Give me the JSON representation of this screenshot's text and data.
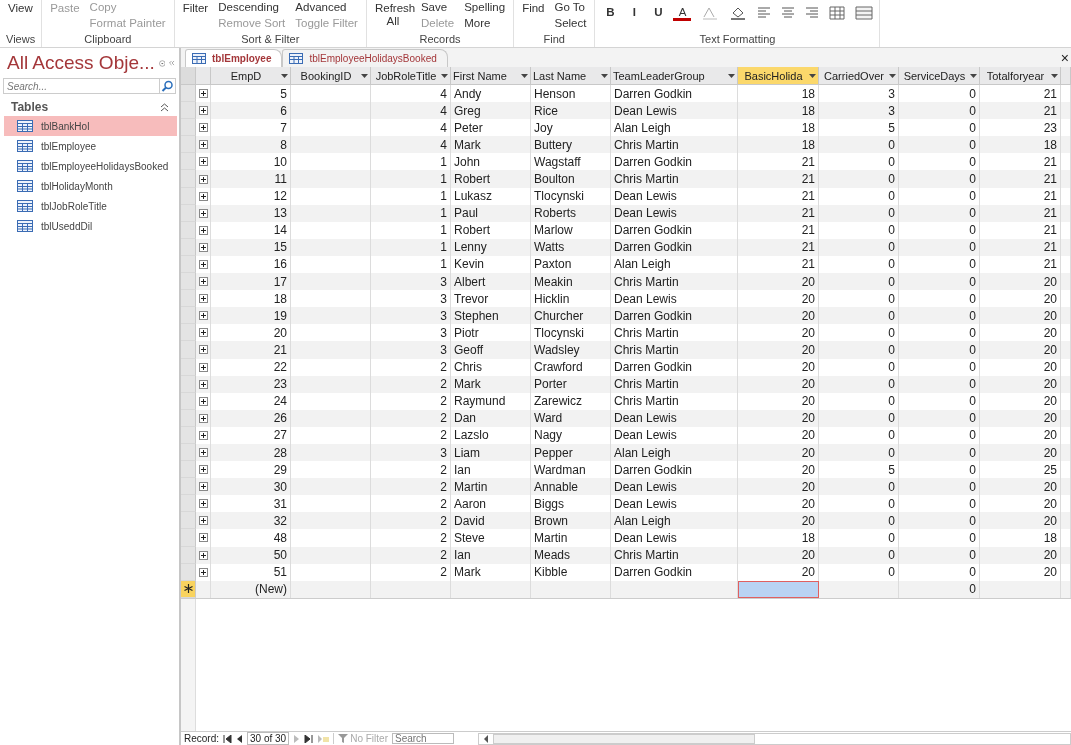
{
  "ribbon": {
    "groups": [
      {
        "label": "Views",
        "columns": [
          [
            {
              "label": "View",
              "kind": "large",
              "disabled": false
            }
          ]
        ]
      },
      {
        "label": "Clipboard",
        "columns": [
          [
            {
              "label": "Paste",
              "kind": "large",
              "disabled": true
            }
          ],
          [
            {
              "label": "Copy",
              "kind": "small",
              "disabled": true
            },
            {
              "label": "Format Painter",
              "kind": "small",
              "disabled": true
            }
          ]
        ]
      },
      {
        "label": "Sort & Filter",
        "columns": [
          [
            {
              "label": "Filter",
              "kind": "large",
              "disabled": false
            }
          ],
          [
            {
              "label": "Descending",
              "kind": "small",
              "disabled": false
            },
            {
              "label": "Remove Sort",
              "kind": "small",
              "disabled": true
            }
          ],
          [
            {
              "label": "Advanced",
              "kind": "small",
              "disabled": false
            },
            {
              "label": "Toggle Filter",
              "kind": "small",
              "disabled": true
            }
          ]
        ]
      },
      {
        "label": "Records",
        "columns": [
          [
            {
              "label": "Refresh All",
              "kind": "large",
              "disabled": false
            }
          ],
          [
            {
              "label": "Save",
              "kind": "small",
              "disabled": false
            },
            {
              "label": "Delete",
              "kind": "small",
              "disabled": true
            }
          ],
          [
            {
              "label": "Spelling",
              "kind": "small",
              "disabled": false
            },
            {
              "label": "More",
              "kind": "small",
              "disabled": false
            }
          ]
        ]
      },
      {
        "label": "Find",
        "columns": [
          [
            {
              "label": "Find",
              "kind": "large",
              "disabled": false
            }
          ],
          [
            {
              "label": "Go To",
              "kind": "small",
              "disabled": false
            },
            {
              "label": "Select",
              "kind": "small",
              "disabled": false
            }
          ]
        ]
      },
      {
        "label": "Text Formatting",
        "columns": [
          [
            {
              "label": "B",
              "kind": "format",
              "disabled": false
            }
          ],
          [
            {
              "label": "I",
              "kind": "format",
              "disabled": false
            }
          ],
          [
            {
              "label": "U",
              "kind": "format",
              "disabled": false
            }
          ],
          [
            {
              "label": "A",
              "kind": "font-color",
              "disabled": false
            }
          ]
        ]
      }
    ]
  },
  "nav_pane": {
    "title": "All Access Obje...",
    "search": {
      "placeholder": "Search..."
    },
    "section": "Tables",
    "items": [
      {
        "label": "tblBankHol",
        "selected": true
      },
      {
        "label": "tblEmployee",
        "selected": false
      },
      {
        "label": "tblEmployeeHolidaysBooked",
        "selected": false
      },
      {
        "label": "tblHolidayMonth",
        "selected": false
      },
      {
        "label": "tblJobRoleTitle",
        "selected": false
      },
      {
        "label": "tblUseddDil",
        "selected": false
      }
    ]
  },
  "tabs": [
    {
      "label": "tblEmployee",
      "selected": true
    },
    {
      "label": "tblEmployeeHolidaysBooked",
      "selected": false
    }
  ],
  "close_glyph": "×",
  "table": {
    "columns": [
      {
        "label": "EmpD",
        "kind": "number",
        "selected": false
      },
      {
        "label": "BookingID",
        "kind": "number",
        "selected": false
      },
      {
        "label": "JobRoleTitle",
        "kind": "number",
        "selected": false
      },
      {
        "label": "First Name",
        "kind": "text",
        "selected": false
      },
      {
        "label": "Last Name",
        "kind": "text",
        "selected": false
      },
      {
        "label": "TeamLeaderGroup",
        "kind": "text",
        "selected": false
      },
      {
        "label": "BasicHolida",
        "kind": "number",
        "selected": true
      },
      {
        "label": "CarriedOver",
        "kind": "number",
        "selected": false
      },
      {
        "label": "ServiceDays",
        "kind": "number",
        "selected": false
      },
      {
        "label": "Totalforyear",
        "kind": "number",
        "selected": false
      }
    ],
    "rows": [
      [
        "5",
        null,
        "4",
        "Andy",
        "Henson",
        "Darren Godkin",
        "18",
        "3",
        "0",
        "21"
      ],
      [
        "6",
        null,
        "4",
        "Greg",
        "Rice",
        "Dean Lewis",
        "18",
        "3",
        "0",
        "21"
      ],
      [
        "7",
        null,
        "4",
        "Peter",
        "Joy",
        "Alan Leigh",
        "18",
        "5",
        "0",
        "23"
      ],
      [
        "8",
        null,
        "4",
        "Mark",
        "Buttery",
        "Chris Martin",
        "18",
        "0",
        "0",
        "18"
      ],
      [
        "10",
        null,
        "1",
        "John",
        "Wagstaff",
        "Darren Godkin",
        "21",
        "0",
        "0",
        "21"
      ],
      [
        "11",
        null,
        "1",
        "Robert",
        "Boulton",
        "Chris Martin",
        "21",
        "0",
        "0",
        "21"
      ],
      [
        "12",
        null,
        "1",
        "Lukasz",
        "Tlocynski",
        "Dean Lewis",
        "21",
        "0",
        "0",
        "21"
      ],
      [
        "13",
        null,
        "1",
        "Paul",
        "Roberts",
        "Dean Lewis",
        "21",
        "0",
        "0",
        "21"
      ],
      [
        "14",
        null,
        "1",
        "Robert",
        "Marlow",
        "Darren Godkin",
        "21",
        "0",
        "0",
        "21"
      ],
      [
        "15",
        null,
        "1",
        "Lenny",
        "Watts",
        "Darren Godkin",
        "21",
        "0",
        "0",
        "21"
      ],
      [
        "16",
        null,
        "1",
        "Kevin",
        "Paxton",
        "Alan Leigh",
        "21",
        "0",
        "0",
        "21"
      ],
      [
        "17",
        null,
        "3",
        "Albert",
        "Meakin",
        "Chris Martin",
        "20",
        "0",
        "0",
        "20"
      ],
      [
        "18",
        null,
        "3",
        "Trevor",
        "Hicklin",
        "Dean Lewis",
        "20",
        "0",
        "0",
        "20"
      ],
      [
        "19",
        null,
        "3",
        "Stephen",
        "Churcher",
        "Darren Godkin",
        "20",
        "0",
        "0",
        "20"
      ],
      [
        "20",
        null,
        "3",
        "Piotr",
        "Tlocynski",
        "Chris Martin",
        "20",
        "0",
        "0",
        "20"
      ],
      [
        "21",
        null,
        "3",
        "Geoff",
        "Wadsley",
        "Chris Martin",
        "20",
        "0",
        "0",
        "20"
      ],
      [
        "22",
        null,
        "2",
        "Chris",
        "Crawford",
        "Darren Godkin",
        "20",
        "0",
        "0",
        "20"
      ],
      [
        "23",
        null,
        "2",
        "Mark",
        "Porter",
        "Chris Martin",
        "20",
        "0",
        "0",
        "20"
      ],
      [
        "24",
        null,
        "2",
        "Raymund",
        "Zarewicz",
        "Chris Martin",
        "20",
        "0",
        "0",
        "20"
      ],
      [
        "26",
        null,
        "2",
        "Dan",
        "Ward",
        "Dean Lewis",
        "20",
        "0",
        "0",
        "20"
      ],
      [
        "27",
        null,
        "2",
        "Lazslo",
        "Nagy",
        "Dean Lewis",
        "20",
        "0",
        "0",
        "20"
      ],
      [
        "28",
        null,
        "3",
        "Liam",
        "Pepper",
        "Alan Leigh",
        "20",
        "0",
        "0",
        "20"
      ],
      [
        "29",
        null,
        "2",
        "Ian",
        "Wardman",
        "Darren Godkin",
        "20",
        "5",
        "0",
        "25"
      ],
      [
        "30",
        null,
        "2",
        "Martin",
        "Annable",
        "Dean Lewis",
        "20",
        "0",
        "0",
        "20"
      ],
      [
        "31",
        null,
        "2",
        "Aaron",
        "Biggs",
        "Dean Lewis",
        "20",
        "0",
        "0",
        "20"
      ],
      [
        "32",
        null,
        "2",
        "David",
        "Brown",
        "Alan Leigh",
        "20",
        "0",
        "0",
        "20"
      ],
      [
        "48",
        null,
        "2",
        "Steve",
        "Martin",
        "Dean Lewis",
        "18",
        "0",
        "0",
        "18"
      ],
      [
        "50",
        null,
        "2",
        "Ian",
        "Meads",
        "Chris Martin",
        "20",
        "0",
        "0",
        "20"
      ],
      [
        "51",
        null,
        "2",
        "Mark",
        "Kibble",
        "Darren Godkin",
        "20",
        "0",
        "0",
        "20"
      ]
    ],
    "new_row": {
      "cells": [
        {
          "text": "(New)",
          "selected": false
        },
        {
          "selected": false
        },
        {
          "selected": false
        },
        {
          "selected": false
        },
        {
          "selected": false
        },
        {
          "selected": false
        },
        {
          "selected": true
        },
        {
          "selected": false
        },
        {
          "text": "0",
          "selected": false
        },
        {
          "selected": false
        }
      ]
    }
  },
  "record_nav": {
    "label": "Record:",
    "position": "30 of 30",
    "filter": {
      "label": "No Filter",
      "disabled": true
    },
    "search": {
      "placeholder": "Search"
    }
  }
}
